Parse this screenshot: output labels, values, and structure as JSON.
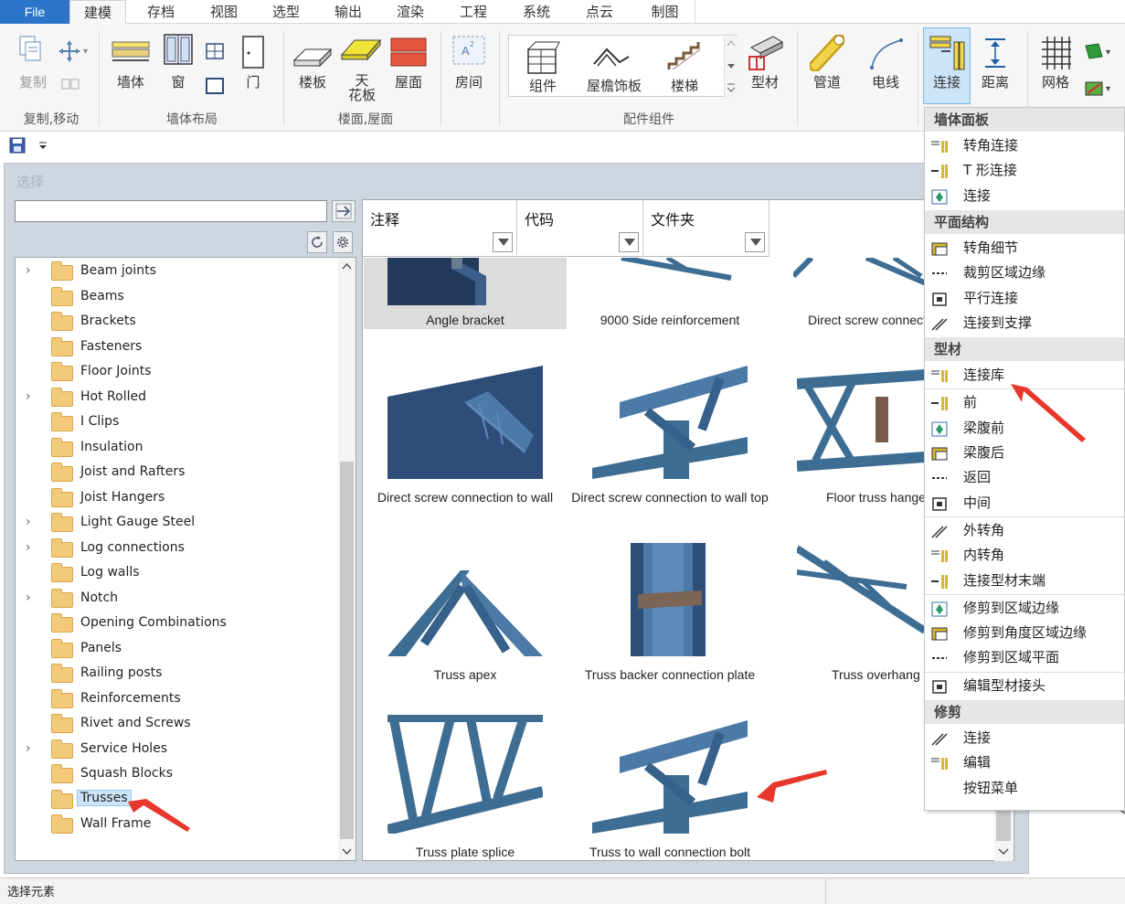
{
  "tabs": {
    "file": "File",
    "items": [
      "建模",
      "存档",
      "视图",
      "选型",
      "输出",
      "渲染",
      "工程",
      "系统",
      "点云",
      "制图"
    ]
  },
  "ribbon": {
    "groups": [
      {
        "label": "复制,移动"
      },
      {
        "label": "墙体布局"
      },
      {
        "label": "楼面,屋面"
      },
      {
        "label": "配件组件"
      }
    ],
    "buttons": {
      "copy": "复制",
      "wall": "墙体",
      "window": "窗",
      "door": "门",
      "floor": "楼板",
      "ceiling": "天\n花板",
      "roof": "屋面",
      "room": "房间",
      "component": "组件",
      "eave": "屋檐饰板",
      "stairs": "楼梯",
      "profile": "型材",
      "pipe": "管道",
      "wire": "电线",
      "connect": "连接",
      "distance": "距离",
      "grid": "网格"
    }
  },
  "window": {
    "title": "选择",
    "search_value": "",
    "go_icon": "arrow-right-icon",
    "columns": [
      {
        "title": "注释"
      },
      {
        "title": "代码"
      },
      {
        "title": "文件夹"
      }
    ]
  },
  "tree": {
    "items": [
      {
        "label": "Beam joints",
        "expandable": true
      },
      {
        "label": "Beams",
        "expandable": false
      },
      {
        "label": "Brackets",
        "expandable": false
      },
      {
        "label": "Fasteners",
        "expandable": false
      },
      {
        "label": "Floor Joints",
        "expandable": false
      },
      {
        "label": "Hot Rolled",
        "expandable": true
      },
      {
        "label": "I Clips",
        "expandable": false
      },
      {
        "label": "Insulation",
        "expandable": false
      },
      {
        "label": "Joist and Rafters",
        "expandable": false
      },
      {
        "label": "Joist Hangers",
        "expandable": false
      },
      {
        "label": "Light Gauge Steel",
        "expandable": true
      },
      {
        "label": "Log connections",
        "expandable": true
      },
      {
        "label": "Log walls",
        "expandable": false
      },
      {
        "label": "Notch",
        "expandable": true
      },
      {
        "label": "Opening Combinations",
        "expandable": false
      },
      {
        "label": "Panels",
        "expandable": false
      },
      {
        "label": "Railing posts",
        "expandable": false
      },
      {
        "label": "Reinforcements",
        "expandable": false
      },
      {
        "label": "Rivet and Screws",
        "expandable": false
      },
      {
        "label": "Service Holes",
        "expandable": true
      },
      {
        "label": "Squash Blocks",
        "expandable": false
      },
      {
        "label": "Trusses",
        "expandable": false,
        "selected": true
      },
      {
        "label": "Wall Frame",
        "expandable": false
      }
    ]
  },
  "gallery": {
    "items": [
      {
        "label": "Angle bracket"
      },
      {
        "label": "9000 Side reinforcement"
      },
      {
        "label": "Direct screw connect"
      },
      {
        "label": "Direct screw connection to wall"
      },
      {
        "label": "Direct screw connection to wall top"
      },
      {
        "label": "Floor truss hanger"
      },
      {
        "label": "Truss apex"
      },
      {
        "label": "Truss backer connection plate"
      },
      {
        "label": "Truss overhang"
      },
      {
        "label": "Truss plate splice"
      },
      {
        "label": "Truss to wall connection bolt"
      }
    ]
  },
  "menu": {
    "sections": [
      {
        "header": "墙体面板",
        "items": [
          "转角连接",
          "T 形连接",
          "连接"
        ]
      },
      {
        "header": "平面结构",
        "items": [
          "转角细节",
          "裁剪区域边缘",
          "平行连接",
          "连接到支撑"
        ]
      },
      {
        "header": "型材",
        "items": [
          "连接库",
          "前",
          "梁腹前",
          "梁腹后",
          "返回",
          "中间",
          "外转角",
          "内转角",
          "连接型材末端",
          "修剪到区域边缘",
          "修剪到角度区域边缘",
          "修剪到区域平面",
          "编辑型材接头"
        ]
      },
      {
        "header": "修剪",
        "items": [
          "连接",
          "编辑",
          "按钮菜单"
        ]
      }
    ]
  },
  "status": {
    "text": "选择元素"
  },
  "colors": {
    "accent": "#2b74c7",
    "steel": "#3e6d93",
    "annotation": "#e8372c"
  }
}
